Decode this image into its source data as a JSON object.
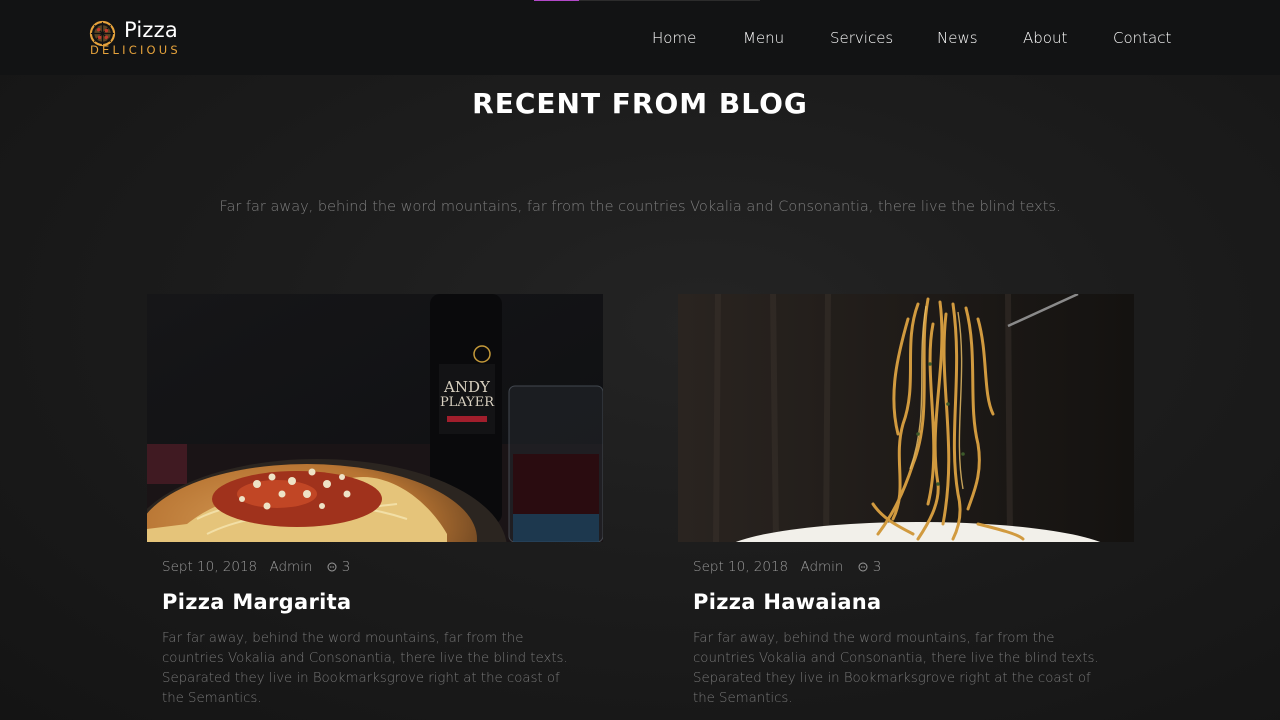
{
  "brand": {
    "name": "Pizza",
    "subtitle": "DELICIOUS",
    "accent_color": "#e6a33c",
    "icon": "pizza-icon"
  },
  "nav": {
    "items": [
      {
        "label": "Home"
      },
      {
        "label": "Menu"
      },
      {
        "label": "Services"
      },
      {
        "label": "News"
      },
      {
        "label": "About"
      },
      {
        "label": "Contact"
      }
    ],
    "progress_color": "#b248c8",
    "progress_fraction": 0.2
  },
  "blog": {
    "title": "RECENT FROM BLOG",
    "subtitle": "Far far away, behind the word mountains, far from the countries Vokalia and Consonantia, there live the blind texts.",
    "posts": [
      {
        "date": "Sept 10, 2018",
        "author": "Admin",
        "comments": "3",
        "comment_icon": "chat-icon",
        "title": "Pizza Margarita",
        "text": "Far far away, behind the word mountains, far from the countries Vokalia and Consonantia, there live the blind texts. Separated they live in Bookmarksgrove right at the coast of the Semantics."
      },
      {
        "date": "Sept 10, 2018",
        "author": "Admin",
        "comments": "3",
        "comment_icon": "chat-icon",
        "title": "Pizza Hawaiana",
        "text": "Far far away, behind the word mountains, far from the countries Vokalia and Consonantia, there live the blind texts. Separated they live in Bookmarksgrove right at the coast of the Semantics."
      }
    ]
  }
}
